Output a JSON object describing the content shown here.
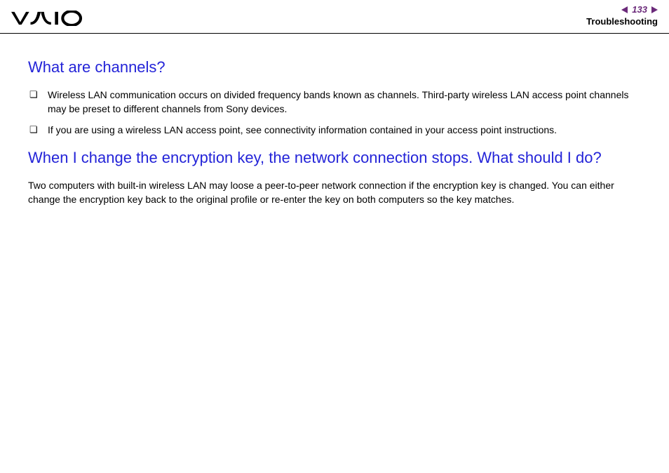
{
  "header": {
    "page_number": "133",
    "section": "Troubleshooting"
  },
  "content": {
    "question1": {
      "heading": "What are channels?",
      "bullets": [
        "Wireless LAN communication occurs on divided frequency bands known as channels. Third-party wireless LAN access point channels may be preset to different channels from Sony devices.",
        "If you are using a wireless LAN access point, see connectivity information contained in your access point instructions."
      ]
    },
    "question2": {
      "heading": "When I change the encryption key, the network connection stops. What should I do?",
      "body": "Two computers with built-in wireless LAN may loose a peer-to-peer network connection if the encryption key is changed. You can either change the encryption key back to the original profile or re-enter the key on both computers so the key matches."
    }
  }
}
